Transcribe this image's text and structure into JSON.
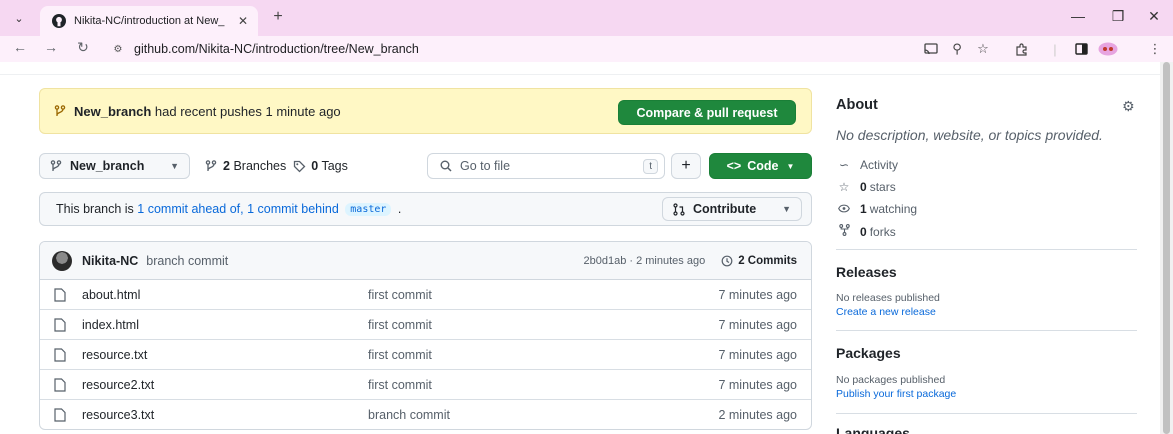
{
  "browser": {
    "tab_title": "Nikita-NC/introduction at New_",
    "url": "github.com/Nikita-NC/introduction/tree/New_branch"
  },
  "banner": {
    "branch": "New_branch",
    "text": " had recent pushes 1 minute ago",
    "button": "Compare & pull request"
  },
  "repo_bar": {
    "branch": "New_branch",
    "branches_count": "2",
    "branches_label": "Branches",
    "tags_count": "0",
    "tags_label": "Tags",
    "search_placeholder": "Go to file",
    "search_shortcut": "t",
    "code_button": "Code"
  },
  "ahead_behind": {
    "prefix": "This branch is ",
    "ahead": "1 commit ahead of,",
    "behind": "1 commit behind",
    "base": "master",
    "suffix": " .",
    "contribute": "Contribute"
  },
  "latest_commit": {
    "author": "Nikita-NC",
    "message": "branch commit",
    "meta": "2b0d1ab · 2 minutes ago",
    "commits": "2 Commits"
  },
  "files": [
    {
      "name": "about.html",
      "message": "first commit",
      "time": "7 minutes ago"
    },
    {
      "name": "index.html",
      "message": "first commit",
      "time": "7 minutes ago"
    },
    {
      "name": "resource.txt",
      "message": "first commit",
      "time": "7 minutes ago"
    },
    {
      "name": "resource2.txt",
      "message": "first commit",
      "time": "7 minutes ago"
    },
    {
      "name": "resource3.txt",
      "message": "branch commit",
      "time": "2 minutes ago"
    }
  ],
  "about": {
    "heading": "About",
    "description": "No description, website, or topics provided.",
    "activity": "Activity",
    "stars_count": "0",
    "stars_label": "stars",
    "watching_count": "1",
    "watching_label": "watching",
    "forks_count": "0",
    "forks_label": "forks"
  },
  "releases": {
    "heading": "Releases",
    "note": "No releases published",
    "link": "Create a new release"
  },
  "packages": {
    "heading": "Packages",
    "note": "No packages published",
    "link": "Publish your first package"
  },
  "languages": {
    "heading": "Languages"
  }
}
